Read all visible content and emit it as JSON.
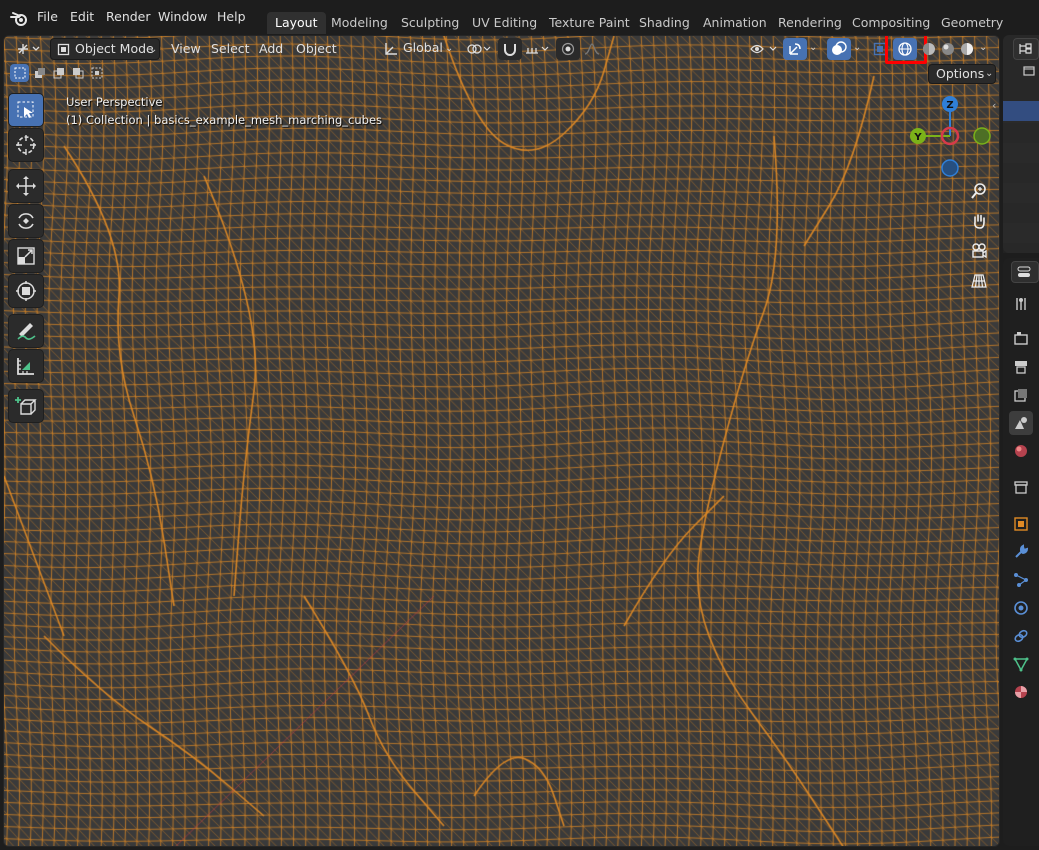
{
  "menu": {
    "file": "File",
    "edit": "Edit",
    "render": "Render",
    "window": "Window",
    "help": "Help"
  },
  "workspaces": [
    "Layout",
    "Modeling",
    "Sculpting",
    "UV Editing",
    "Texture Paint",
    "Shading",
    "Animation",
    "Rendering",
    "Compositing",
    "Geometry Nodes"
  ],
  "active_workspace": "Layout",
  "viewport_header": {
    "mode": "Object Mode",
    "view": "View",
    "select": "Select",
    "add": "Add",
    "object": "Object",
    "orientation": "Global",
    "options": "Options"
  },
  "overlay": {
    "perspective": "User Perspective",
    "collection": "(1) Collection | basics_example_mesh_marching_cubes"
  },
  "gizmo": {
    "z": "Z",
    "y": "Y"
  },
  "colors": {
    "wire": "#e08a25",
    "viewport_bg": "#3a3a3a",
    "accent": "#4772b3",
    "highlight_box": "#ff0000",
    "gizmo_x": "#d63a4a",
    "gizmo_y": "#7bb219",
    "gizmo_z": "#2f7fd8"
  },
  "icons": {
    "blender_logo": "blender-logo-icon",
    "wireframe_shading": "wireframe-shading-icon"
  }
}
